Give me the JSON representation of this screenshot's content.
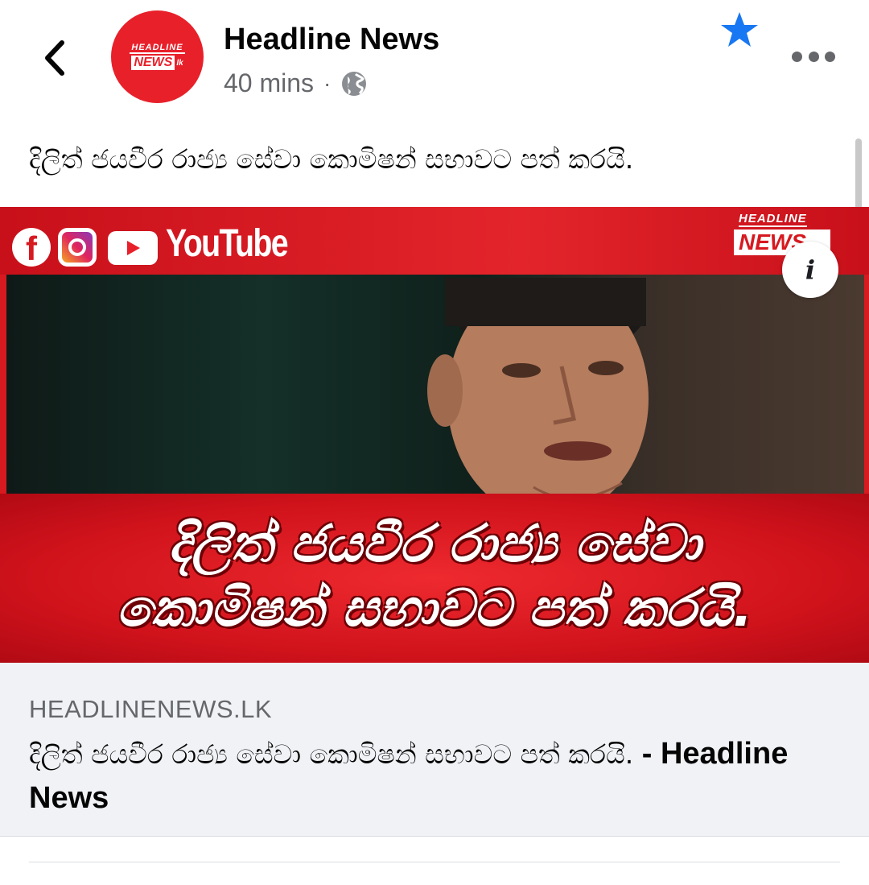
{
  "header": {
    "page_name": "Headline News",
    "time": "40 mins",
    "separator": "·",
    "avatar": {
      "top_text": "HEADLINE",
      "news_text": "NEWS",
      "lk_text": "lk"
    },
    "icons": {
      "back": "chevron-left-icon",
      "star": "star-icon",
      "more": "more-dots-icon",
      "globe": "globe-icon"
    },
    "star_color": "#1877f2"
  },
  "post": {
    "text": "දිලිත් ජයවීර රාජ්‍ය සේවා කොමිෂන් සභාවට පත් කරයි."
  },
  "preview_image": {
    "social_text": "YouTube",
    "logo_top": "HEADLINE",
    "logo_news": "NEWS",
    "headline_line1": "දිලිත් ජයවීර රාජ්‍ය සේවා",
    "headline_line2": "කොමිෂන් සභාවට පත් කරයි.",
    "info_label": "i",
    "accent_color": "#d71920"
  },
  "link": {
    "domain": "HEADLINENEWS.LK",
    "title_sinhala": "දිලිත් ජයවීර රාජ්‍ය සේවා කොමිෂන් සභාවට පත් කරයි.",
    "title_suffix": " - Headline News"
  }
}
